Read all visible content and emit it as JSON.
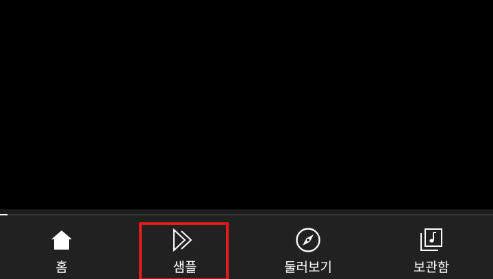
{
  "player": {
    "progress_fraction": 0.015
  },
  "bottom_nav": {
    "items": [
      {
        "label": "홈",
        "icon": "home-icon"
      },
      {
        "label": "샘플",
        "icon": "samples-icon"
      },
      {
        "label": "둘러보기",
        "icon": "explore-icon"
      },
      {
        "label": "보관함",
        "icon": "library-icon"
      }
    ],
    "selected_index": 1
  },
  "colors": {
    "background": "#000000",
    "nav_background": "#212121",
    "text": "#ffffff",
    "highlight": "#e01b1b"
  }
}
